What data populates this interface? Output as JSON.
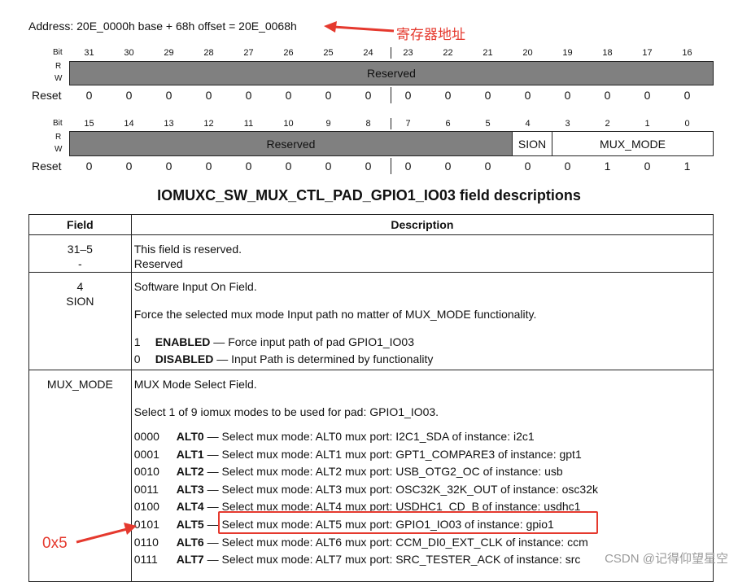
{
  "address_line": "Address: 20E_0000h base + 68h offset = 20E_0068h",
  "annotations": {
    "register_address": "寄存器地址",
    "mux_value": "0x5"
  },
  "register": {
    "bit_label": "Bit",
    "r_label": "R",
    "w_label": "W",
    "reset_label": "Reset",
    "upper_bits": [
      "31",
      "30",
      "29",
      "28",
      "27",
      "26",
      "25",
      "24",
      "23",
      "22",
      "21",
      "20",
      "19",
      "18",
      "17",
      "16"
    ],
    "upper_reserved": "Reserved",
    "upper_reset": [
      "0",
      "0",
      "0",
      "0",
      "0",
      "0",
      "0",
      "0",
      "0",
      "0",
      "0",
      "0",
      "0",
      "0",
      "0",
      "0"
    ],
    "lower_bits": [
      "15",
      "14",
      "13",
      "12",
      "11",
      "10",
      "9",
      "8",
      "7",
      "6",
      "5",
      "4",
      "3",
      "2",
      "1",
      "0"
    ],
    "lower_reserved": "Reserved",
    "sion_field": "SION",
    "mux_mode_field": "MUX_MODE",
    "lower_reset": [
      "0",
      "0",
      "0",
      "0",
      "0",
      "0",
      "0",
      "0",
      "0",
      "0",
      "0",
      "0",
      "0",
      "1",
      "0",
      "1"
    ]
  },
  "table_title": "IOMUXC_SW_MUX_CTL_PAD_GPIO1_IO03 field descriptions",
  "table": {
    "headers": {
      "field": "Field",
      "description": "Description"
    },
    "row1": {
      "field_bits": "31–5",
      "field_name": "-",
      "line1": "This field is reserved.",
      "line2": "Reserved"
    },
    "row2": {
      "field_bits": "4",
      "field_name": "SION",
      "line1": "Software Input On Field.",
      "line2": "Force the selected mux mode Input path no matter of MUX_MODE functionality.",
      "opt1_code": "1",
      "opt1_name": "ENABLED",
      "opt1_text": " — Force input path of pad GPIO1_IO03",
      "opt0_code": "0",
      "opt0_name": "DISABLED",
      "opt0_text": " — Input Path is determined by functionality"
    },
    "row3": {
      "field_name": "MUX_MODE",
      "line1": "MUX Mode Select Field.",
      "line2": "Select 1 of 9 iomux modes to be used for pad: GPIO1_IO03.",
      "alts": [
        {
          "code": "0000",
          "name": "ALT0",
          "text": " — Select mux mode: ALT0 mux port: I2C1_SDA of instance: i2c1"
        },
        {
          "code": "0001",
          "name": "ALT1",
          "text": " — Select mux mode: ALT1 mux port: GPT1_COMPARE3 of instance: gpt1"
        },
        {
          "code": "0010",
          "name": "ALT2",
          "text": " — Select mux mode: ALT2 mux port: USB_OTG2_OC of instance: usb"
        },
        {
          "code": "0011",
          "name": "ALT3",
          "text": " — Select mux mode: ALT3 mux port: OSC32K_32K_OUT of instance: osc32k"
        },
        {
          "code": "0100",
          "name": "ALT4",
          "text": " — Select mux mode: ALT4 mux port: USDHC1_CD_B of instance: usdhc1"
        },
        {
          "code": "0101",
          "name": "ALT5",
          "text": " — Select mux mode: ALT5 mux port: GPIO1_IO03 of instance: gpio1"
        },
        {
          "code": "0110",
          "name": "ALT6",
          "text": " — Select mux mode: ALT6 mux port: CCM_DI0_EXT_CLK of instance: ccm"
        },
        {
          "code": "0111",
          "name": "ALT7",
          "text": " — Select mux mode: ALT7 mux port: SRC_TESTER_ACK of instance: src"
        }
      ]
    }
  },
  "watermark": "CSDN @记得仰望星空"
}
